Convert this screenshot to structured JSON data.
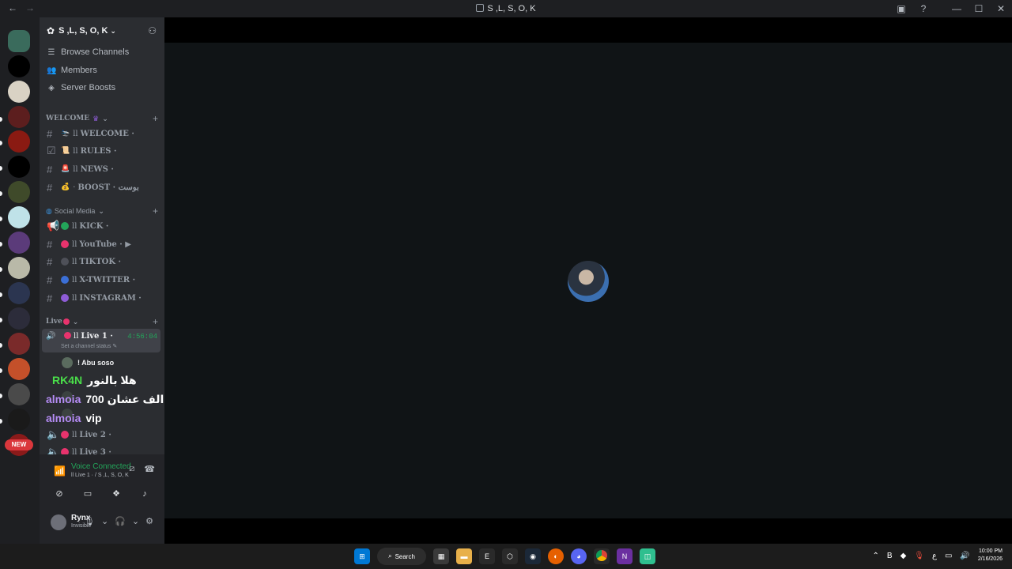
{
  "window": {
    "title": "S ,L, S, O, K",
    "back": "←",
    "forward": "→"
  },
  "server": {
    "name": "S ,L, S, O, K"
  },
  "menu": [
    {
      "label": "Browse Channels",
      "icon": "browse-channels-icon"
    },
    {
      "label": "Members",
      "icon": "members-icon"
    },
    {
      "label": "Server Boosts",
      "icon": "boost-icon"
    }
  ],
  "categories": {
    "welcome": "WELCOME",
    "social": "Social Media",
    "live": "Live"
  },
  "channels_welcome": [
    {
      "label": "WELCOME ·",
      "prefix": "ll"
    },
    {
      "label": "RULES ·",
      "prefix": "ll"
    },
    {
      "label": "NEWS ·",
      "prefix": "ll"
    },
    {
      "label": "BOOST · بوست",
      "prefix": "·"
    }
  ],
  "channels_social": [
    {
      "label": "KICK ·",
      "prefix": "ll",
      "color": "#23a55a"
    },
    {
      "label": "YouTube · ▶",
      "prefix": "ll",
      "color": "#e8336d"
    },
    {
      "label": "TIKTOK ·",
      "prefix": "ll",
      "color": "#4e5058"
    },
    {
      "label": "X-TWITTER ·",
      "prefix": "ll",
      "color": "#3b6fd6"
    },
    {
      "label": "INSTAGRAM ·",
      "prefix": "ll",
      "color": "#8e5cd6"
    }
  ],
  "live_active": {
    "name": "Live 1 ·",
    "prefix": "ll",
    "timer": "4:56:04",
    "status": "Set a channel status"
  },
  "members": [
    {
      "name": "! Abu soso"
    }
  ],
  "overlay_chat": [
    {
      "user": "RK4N",
      "msg": "هلا بالنور",
      "color": "#4ade4a"
    },
    {
      "user": "almoia",
      "msg": "700 الف عشان",
      "color": "#b58cf5"
    },
    {
      "user": "almoia",
      "msg": "vip",
      "color": "#b58cf5"
    }
  ],
  "live_other": [
    {
      "label": "Live 2 ·",
      "prefix": "ll"
    },
    {
      "label": "Live 3 ·",
      "prefix": "ll"
    }
  ],
  "voice": {
    "title": "Voice Connected",
    "subtitle": "ll Live 1 · / S ,L, S, O, K"
  },
  "user": {
    "name": "Rynx",
    "status": "Invisible"
  },
  "new_badge": "NEW",
  "taskbar": {
    "search": "Search",
    "time": "10:00 PM",
    "date": "2/16/2026",
    "lang": "ع"
  }
}
